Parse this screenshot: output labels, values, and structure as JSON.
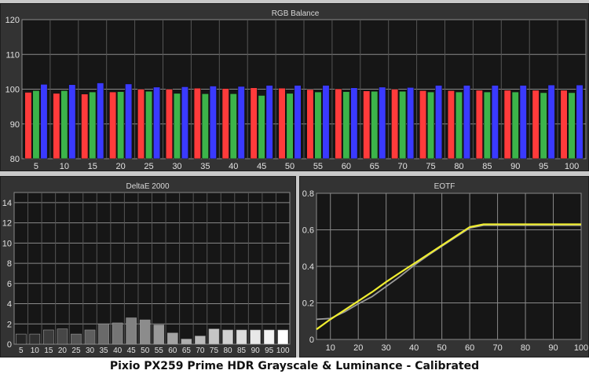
{
  "caption": "Pixio PX259 Prime HDR Grayscale & Luminance - Calibrated",
  "colors": {
    "background": "#c9c9c9",
    "panel": "#333333",
    "red": "#ff3b3b",
    "green": "#3cb44a",
    "blue": "#3a3aff",
    "eotf_target": "#f0ee30",
    "eotf_measured": "#9a9a9a"
  },
  "chart_data": [
    {
      "type": "bar",
      "title": "RGB Balance",
      "categories": [
        "5",
        "10",
        "15",
        "20",
        "25",
        "30",
        "35",
        "40",
        "45",
        "50",
        "55",
        "60",
        "65",
        "70",
        "75",
        "80",
        "85",
        "90",
        "95",
        "100"
      ],
      "ylim": [
        80,
        120
      ],
      "yticks": [
        80,
        90,
        100,
        110,
        120
      ],
      "grid": true,
      "series": [
        {
          "color": "red",
          "values": [
            99.1,
            98.8,
            98.6,
            99.2,
            100.0,
            100.0,
            100.3,
            100.2,
            100.4,
            100.3,
            99.9,
            100.1,
            99.5,
            100.0,
            99.6,
            99.6,
            99.7,
            99.7,
            99.7,
            99.7
          ]
        },
        {
          "color": "green",
          "values": [
            99.6,
            99.6,
            99.2,
            99.3,
            99.4,
            98.8,
            98.7,
            98.7,
            98.2,
            98.8,
            99.2,
            99.3,
            99.4,
            99.4,
            99.2,
            99.2,
            99.2,
            99.2,
            99.0,
            99.0
          ]
        },
        {
          "color": "blue",
          "values": [
            101.4,
            101.3,
            101.8,
            101.5,
            100.6,
            100.7,
            100.9,
            100.8,
            101.1,
            101.1,
            101.1,
            100.4,
            100.6,
            100.5,
            101.1,
            101.1,
            101.1,
            101.1,
            101.2,
            101.2
          ]
        }
      ]
    },
    {
      "type": "bar",
      "title": "DeltaE 2000",
      "categories": [
        "5",
        "10",
        "15",
        "20",
        "25",
        "30",
        "35",
        "40",
        "45",
        "50",
        "55",
        "60",
        "65",
        "70",
        "75",
        "80",
        "85",
        "90",
        "95",
        "100"
      ],
      "values": [
        1.0,
        1.0,
        1.4,
        1.5,
        1.0,
        1.4,
        2.0,
        2.1,
        2.6,
        2.4,
        1.9,
        1.1,
        0.5,
        0.8,
        1.5,
        1.4,
        1.4,
        1.4,
        1.4,
        1.4
      ],
      "ylim": [
        0,
        15
      ],
      "yticks": [
        0,
        2,
        4,
        6,
        8,
        10,
        12,
        14
      ],
      "grid": true
    },
    {
      "type": "line",
      "title": "EOTF",
      "xlim": [
        5,
        100
      ],
      "ylim": [
        0,
        0.8
      ],
      "xticks": [
        10,
        20,
        30,
        40,
        50,
        60,
        70,
        80,
        90,
        100
      ],
      "yticks": [
        0,
        0.2,
        0.4,
        0.6,
        0.8
      ],
      "grid": true,
      "series": [
        {
          "color": "eotf_target",
          "x": [
            5,
            10,
            15,
            20,
            25,
            30,
            35,
            40,
            45,
            50,
            55,
            60,
            65,
            70,
            75,
            80,
            85,
            90,
            95,
            100
          ],
          "y": [
            0.055,
            0.11,
            0.16,
            0.21,
            0.26,
            0.315,
            0.365,
            0.415,
            0.465,
            0.515,
            0.565,
            0.615,
            0.63,
            0.63,
            0.63,
            0.63,
            0.63,
            0.63,
            0.63,
            0.63
          ]
        },
        {
          "color": "eotf_measured",
          "x": [
            5,
            10,
            15,
            20,
            25,
            30,
            35,
            40,
            45,
            50,
            55,
            60,
            65,
            70,
            75,
            80,
            85,
            90,
            95,
            100
          ],
          "y": [
            0.11,
            0.115,
            0.15,
            0.195,
            0.235,
            0.29,
            0.345,
            0.405,
            0.46,
            0.51,
            0.56,
            0.61,
            0.625,
            0.625,
            0.625,
            0.625,
            0.625,
            0.625,
            0.625,
            0.625
          ]
        }
      ]
    }
  ]
}
